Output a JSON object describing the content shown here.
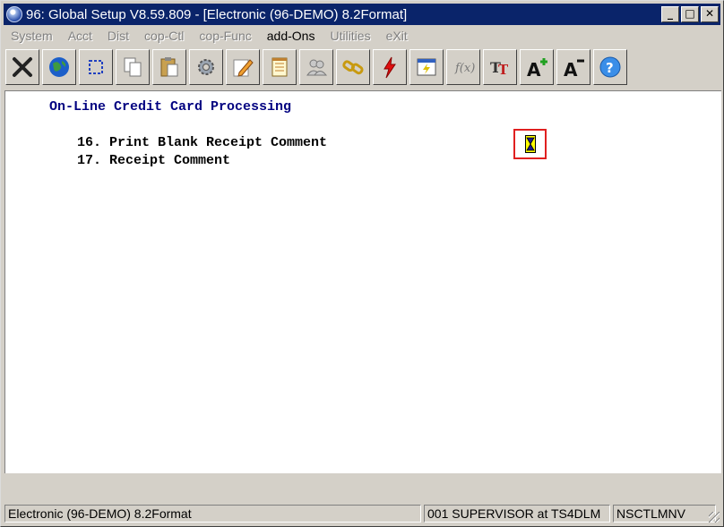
{
  "window": {
    "title": "96: Global Setup V8.59.809 - [Electronic (96-DEMO) 8.2Format]",
    "minimize_glyph": "_",
    "maximize_glyph": "□",
    "close_glyph": "✕"
  },
  "menu": [
    {
      "label": "System",
      "enabled": false
    },
    {
      "label": "Acct",
      "enabled": false
    },
    {
      "label": "Dist",
      "enabled": false
    },
    {
      "label": "cop-Ctl",
      "enabled": false
    },
    {
      "label": "cop-Func",
      "enabled": false
    },
    {
      "label": "add-Ons",
      "enabled": true
    },
    {
      "label": "Utilities",
      "enabled": false
    },
    {
      "label": "eXit",
      "enabled": false
    }
  ],
  "toolbar": {
    "icons": [
      "close-x-icon",
      "globe-icon",
      "select-box-icon",
      "copy-icon",
      "paste-icon",
      "settings-gear-icon",
      "edit-pencil-icon",
      "notepad-icon",
      "users-icon",
      "link-icon",
      "lightning-icon",
      "calendar-icon",
      "function-icon",
      "font-icon",
      "font-increase-icon",
      "font-decrease-icon",
      "help-icon"
    ]
  },
  "content": {
    "heading": "On-Line Credit Card Processing",
    "item16": "16. Print Blank Receipt Comment",
    "item17": "17. Receipt Comment",
    "cursor_icon": "hourglass-icon"
  },
  "status": {
    "left": "Electronic (96-DEMO) 8.2Format",
    "middle": "001 SUPERVISOR at TS4DLM",
    "right": "NSCTLMNV"
  },
  "colors": {
    "titlebar": "#0a246a",
    "heading": "#000080",
    "cursor_highlight": "#e02020",
    "cursor_fill": "#ffff00"
  }
}
